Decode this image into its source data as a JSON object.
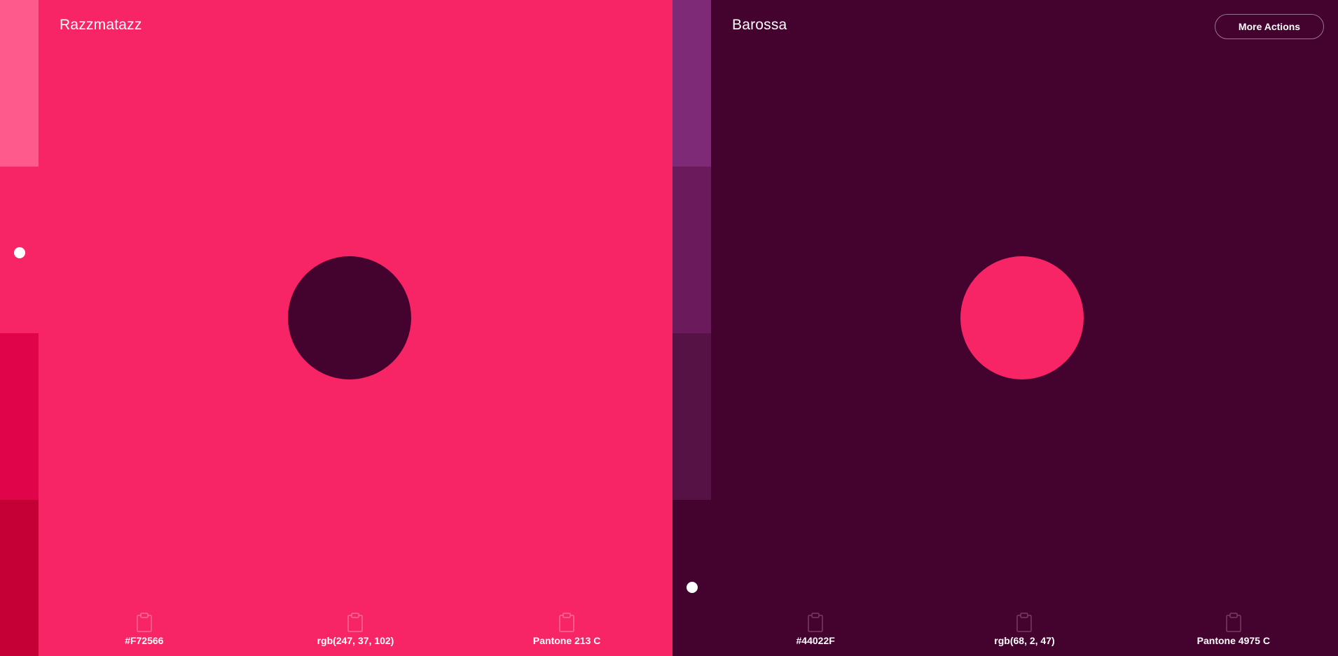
{
  "left_panel": {
    "name": "Razzmatazz",
    "background": "#F72566",
    "circle_color": "#44022F",
    "swatches": [
      "#FF5A8C",
      "#F72566",
      "#E0044A",
      "#C50036"
    ],
    "selected_swatch": 1,
    "codes": [
      {
        "label": "#F72566",
        "icon": "clipboard-icon"
      },
      {
        "label": "rgb(247, 37, 102)",
        "icon": "clipboard-icon"
      },
      {
        "label": "Pantone 213 C",
        "icon": "clipboard-icon"
      }
    ],
    "icon_color": "#FF6A96"
  },
  "right_panel": {
    "name": "Barossa",
    "background": "#44022F",
    "circle_color": "#F72566",
    "swatches": [
      "#7E2A76",
      "#6B1B5C",
      "#571245",
      "#44022F"
    ],
    "selected_swatch": 3,
    "codes": [
      {
        "label": "#44022F",
        "icon": "clipboard-icon"
      },
      {
        "label": "rgb(68, 2, 47)",
        "icon": "clipboard-icon"
      },
      {
        "label": "Pantone 4975 C",
        "icon": "clipboard-icon"
      }
    ],
    "icon_color": "#7A3A66",
    "more_actions_label": "More Actions"
  }
}
